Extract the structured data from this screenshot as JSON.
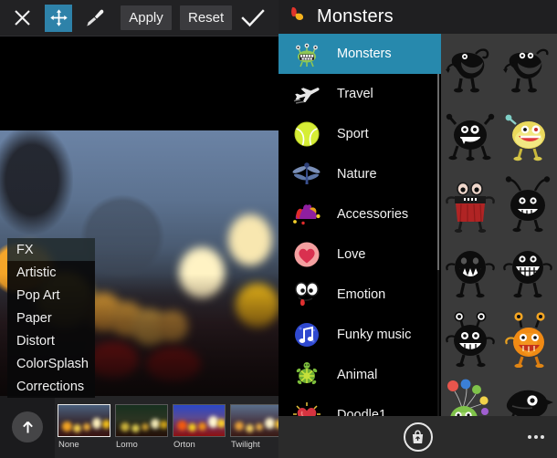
{
  "editor": {
    "toolbar": {
      "close_label": "close-icon",
      "move_label": "move-icon",
      "brush_label": "brush-icon",
      "apply_label": "Apply",
      "reset_label": "Reset",
      "confirm_label": "check-icon",
      "active_tool": "move",
      "active_tool_color": "#2e82a9"
    },
    "effects_menu": {
      "selected": "FX",
      "items": [
        {
          "label": "FX"
        },
        {
          "label": "Artistic"
        },
        {
          "label": "Pop Art"
        },
        {
          "label": "Paper"
        },
        {
          "label": "Distort"
        },
        {
          "label": "ColorSplash"
        },
        {
          "label": "Corrections"
        }
      ]
    },
    "filmstrip": {
      "upload_label": "upload-arrow-icon",
      "selected": "None",
      "thumbnails": [
        {
          "label": "None",
          "class": "t-none"
        },
        {
          "label": "Lomo",
          "class": "t-lomo"
        },
        {
          "label": "Orton",
          "class": "t-orton"
        },
        {
          "label": "Twilight",
          "class": "t-twil"
        }
      ]
    }
  },
  "stickers": {
    "header": {
      "title": "Monsters",
      "logo": "app-logo"
    },
    "selected_category": "Monsters",
    "highlight_color": "#2789ad",
    "categories": [
      {
        "label": "Monsters",
        "icon": "monster-icon"
      },
      {
        "label": "Travel",
        "icon": "airplane-icon"
      },
      {
        "label": "Sport",
        "icon": "tennis-ball-icon"
      },
      {
        "label": "Nature",
        "icon": "dragonfly-icon"
      },
      {
        "label": "Accessories",
        "icon": "jester-hat-icon"
      },
      {
        "label": "Love",
        "icon": "heart-icon"
      },
      {
        "label": "Emotion",
        "icon": "face-tongue-icon"
      },
      {
        "label": "Funky music",
        "icon": "music-note-icon"
      },
      {
        "label": "Animal",
        "icon": "turtle-icon"
      },
      {
        "label": "Doodle1",
        "icon": "doodle-heart-icon"
      }
    ],
    "grid_items": [
      {
        "name": "monster-black-horned",
        "color": "#0d0d0d"
      },
      {
        "name": "monster-black-twoeye",
        "color": "#0d0d0d"
      },
      {
        "name": "monster-black-grin",
        "color": "#0d0d0d"
      },
      {
        "name": "monster-yellow-blob",
        "color": "#e8d85c"
      },
      {
        "name": "monster-red-mouth",
        "color": "#1a1a1a"
      },
      {
        "name": "monster-black-antenna",
        "color": "#0d0d0d"
      },
      {
        "name": "monster-black-fangs",
        "color": "#0d0d0d"
      },
      {
        "name": "monster-black-teeth",
        "color": "#0d0d0d"
      },
      {
        "name": "monster-black-smile",
        "color": "#0d0d0d"
      },
      {
        "name": "monster-orange-pumpkin",
        "color": "#f08a14"
      },
      {
        "name": "monster-green-balloons",
        "color": "#7fc24a"
      },
      {
        "name": "monster-black-bird",
        "color": "#0d0d0d"
      }
    ],
    "bottom_bar": {
      "shop_label": "shop-bag-icon",
      "more_label": "more-options-icon"
    }
  }
}
